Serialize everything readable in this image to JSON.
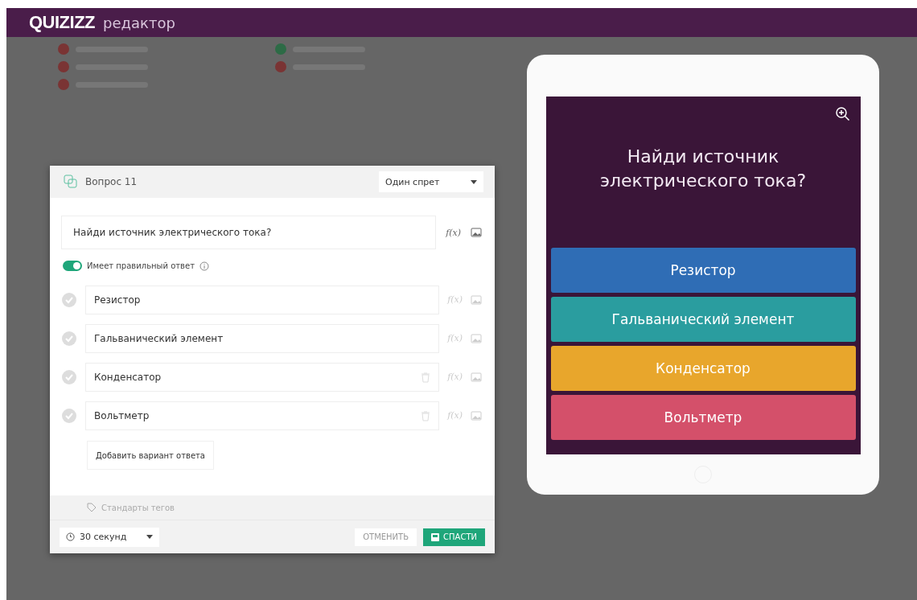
{
  "header": {
    "logo": "QUIZIZZ",
    "title": "редактор"
  },
  "background_legend": [
    {
      "color": "#7a3434"
    },
    {
      "color": "#2d6b46"
    },
    {
      "color": "#7a3434"
    },
    {
      "color": "#7a3434"
    },
    {
      "color": "#7a3434"
    }
  ],
  "editor": {
    "question_label": "Вопрос 11",
    "question_type": "Один спрет",
    "question_text": "Найди источник электрического тока?",
    "formula_label": "f(x)",
    "toggle": {
      "label": "Имеет правильный ответ",
      "on": true
    },
    "answers": [
      {
        "text": "Резистор",
        "correct": false,
        "deletable": false,
        "formula_label": "f(x)"
      },
      {
        "text": "Гальванический элемент",
        "correct": false,
        "deletable": false,
        "formula_label": "f(x)"
      },
      {
        "text": "Конденсатор",
        "correct": false,
        "deletable": true,
        "formula_label": "f(x)"
      },
      {
        "text": "Вольтметр",
        "correct": false,
        "deletable": true,
        "formula_label": "f(x)"
      }
    ],
    "add_answer": "Добавить вариант ответа",
    "tags": "Стандарты тегов",
    "time": "30 секунд",
    "cancel": "ОТМЕНИТЬ",
    "save": "СПАСТИ"
  },
  "preview": {
    "question": "Найди источник электрического тока?",
    "answers": [
      {
        "text": "Резистор",
        "color": "#2f6db5"
      },
      {
        "text": "Гальванический элемент",
        "color": "#2a9d9f"
      },
      {
        "text": "Конденсатор",
        "color": "#e8a62c"
      },
      {
        "text": "Вольтметр",
        "color": "#d4506a"
      }
    ]
  }
}
